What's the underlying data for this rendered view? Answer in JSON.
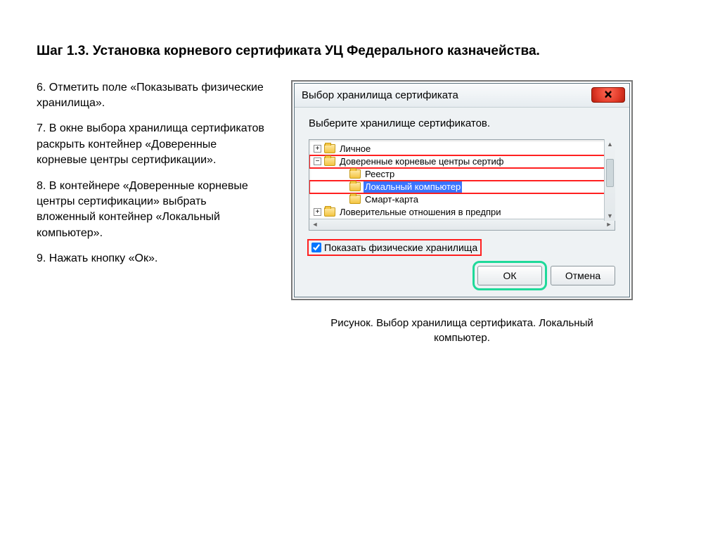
{
  "heading": "Шаг 1.3. Установка корневого сертификата УЦ Федерального казначейства.",
  "steps": {
    "s6": "6. Отметить поле «Показывать физические хранилища».",
    "s7": "7. В окне выбора хранилища сертификатов раскрыть контейнер «Доверенные корневые центры сертификации».",
    "s8": "8. В контейнере «Доверенные корневые центры сертификации» выбрать вложенный контейнер «Локальный компьютер».",
    "s9": "9. Нажать кнопку «Ок»."
  },
  "dialog": {
    "title": "Выбор хранилища сертификата",
    "instruction": "Выберите хранилище сертификатов.",
    "tree": {
      "personal": "Личное",
      "trusted_root": "Доверенные корневые центры сертиф",
      "registry": "Реестр",
      "local_computer": "Локальный компьютер",
      "smartcard": "Смарт-карта",
      "trust_rel": "Ловерительные отношения в предпри"
    },
    "checkbox_label": "Показать физические хранилища",
    "ok_label": "ОК",
    "cancel_label": "Отмена"
  },
  "caption_line1": "Рисунок. Выбор хранилища сертификата. Локальный",
  "caption_line2": "компьютер."
}
